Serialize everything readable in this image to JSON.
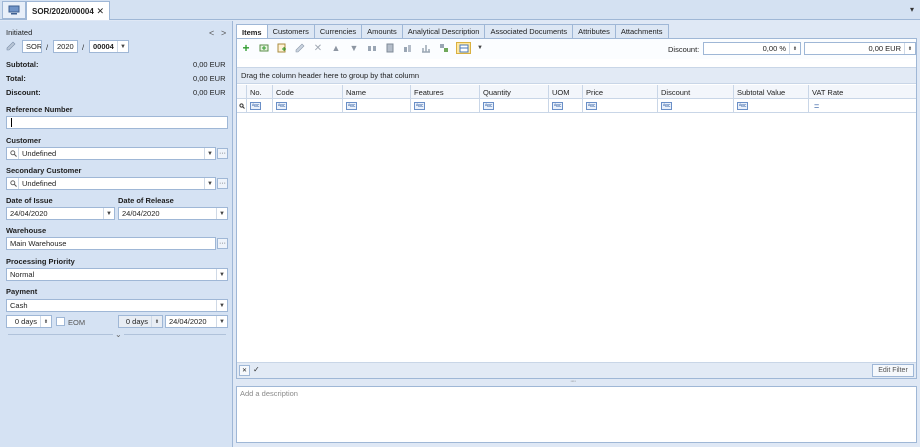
{
  "top": {
    "doc_tab": "SOR/2020/00004",
    "close": "✕",
    "menu_arrow": "▾"
  },
  "left": {
    "status": "Initiated",
    "nav_prev": "<",
    "nav_next": ">",
    "number": {
      "prefix": "SOR",
      "sep1": "/",
      "year": "2020",
      "sep2": "/",
      "num": "00004"
    },
    "summary": [
      {
        "label": "Subtotal:",
        "value": "0,00 EUR"
      },
      {
        "label": "Total:",
        "value": "0,00 EUR"
      },
      {
        "label": "Discount:",
        "value": "0,00 EUR"
      }
    ],
    "reference_label": "Reference Number",
    "reference_value": "",
    "customer_label": "Customer",
    "customer_value": "Undefined",
    "secondary_label": "Secondary Customer",
    "secondary_value": "Undefined",
    "issue_label": "Date of Issue",
    "issue_value": "24/04/2020",
    "release_label": "Date of Release",
    "release_value": "24/04/2020",
    "warehouse_label": "Warehouse",
    "warehouse_value": "Main Warehouse",
    "priority_label": "Processing Priority",
    "priority_value": "Normal",
    "payment_label": "Payment",
    "payment_value": "Cash",
    "days1": "0 days",
    "eom": "EOM",
    "days2": "0 days",
    "pay_date": "24/04/2020",
    "ellipsis": "···",
    "dd": "▼",
    "collapse": "⌄"
  },
  "tabs": [
    "Items",
    "Customers",
    "Currencies",
    "Amounts",
    "Analytical Description",
    "Associated Documents",
    "Attributes",
    "Attachments"
  ],
  "toolbar": {
    "discount_label": "Discount:",
    "discount_pct": "0,00 %",
    "discount_amt": "0,00 EUR"
  },
  "grid": {
    "group_hint": "Drag the column header here to group by that column",
    "columns": [
      "No.",
      "Code",
      "Name",
      "Features",
      "Quantity",
      "UOM",
      "Price",
      "Discount",
      "Subtotal Value",
      "VAT Rate"
    ],
    "abc": "ᴬʙᴄ",
    "filter_eq": "="
  },
  "bottom": {
    "edit_filter": "Edit Filter",
    "x_btn": "✕",
    "check_btn": "✓",
    "splitter": "····"
  },
  "description": {
    "placeholder": "Add a description"
  }
}
